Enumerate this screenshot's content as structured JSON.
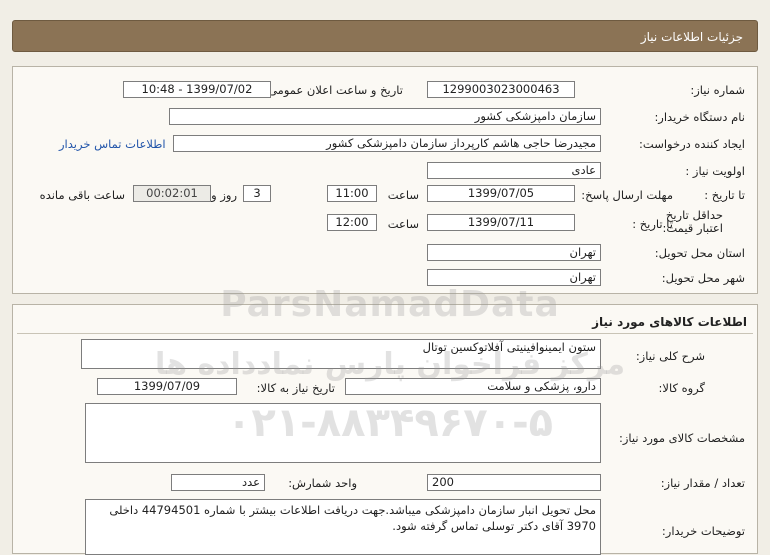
{
  "header": {
    "title": "جزئیات اطلاعات نیاز"
  },
  "need": {
    "number_label": "شماره نیاز:",
    "number": "1299003023000463",
    "announce_label": "تاریخ و ساعت اعلان عمومی:",
    "announce": "1399/07/02 - 10:48",
    "buyer_label": "نام دستگاه خریدار:",
    "buyer": "سازمان دامپزشکی کشور",
    "creator_label": "ایجاد کننده درخواست:",
    "creator": "مجیدرضا حاجی هاشم کارپرداز سازمان دامپزشکی کشور",
    "contact_link": "اطلاعات تماس خریدار",
    "priority_label": "اولویت نیاز :",
    "priority": "عادی",
    "deadline_label": "مهلت ارسال پاسخ:",
    "to_date_label": "تا تاریخ :",
    "deadline_date": "1399/07/05",
    "time_label": "ساعت",
    "deadline_time": "11:00",
    "days": "3",
    "days_label": "روز و",
    "remaining": "00:02:01",
    "remaining_label": "ساعت باقی مانده",
    "validity_label": "حداقل تاریخ اعتبار قیمت:",
    "validity_date": "1399/07/11",
    "validity_time": "12:00",
    "province_label": "استان محل تحویل:",
    "province": "تهران",
    "city_label": "شهر محل تحویل:",
    "city": "تهران"
  },
  "goods": {
    "section_title": "اطلاعات کالاهای مورد نیاز",
    "desc_label": "شرح کلی نیاز:",
    "desc": "ستون ایمینوافینیتی آفلاتوکسین توتال",
    "group_label": "گروه کالا:",
    "group": "دارو، پزشکی و سلامت",
    "need_date_label": "تاریخ نیاز به کالا:",
    "need_date": "1399/07/09",
    "specs_label": "مشخصات کالای مورد نیاز:",
    "specs": "",
    "qty_label": "تعداد / مقدار نیاز:",
    "qty": "200",
    "unit_label": "واحد شمارش:",
    "unit": "عدد",
    "buyer_notes_label": "توضیحات خریدار:",
    "buyer_notes": "محل تحویل انبار سازمان دامپزشکی میباشد.جهت دریافت اطلاعات بیشتر با شماره 44794501 داخلی 3970 آقای دکتر توسلی تماس گرفته شود."
  },
  "watermark": {
    "brand": "ParsNamadData",
    "persian": "مرکز فراخوان پارس نمادداده ها",
    "phone": "۰۲۱-۸۸۳۴۹۶۷۰-۵"
  }
}
